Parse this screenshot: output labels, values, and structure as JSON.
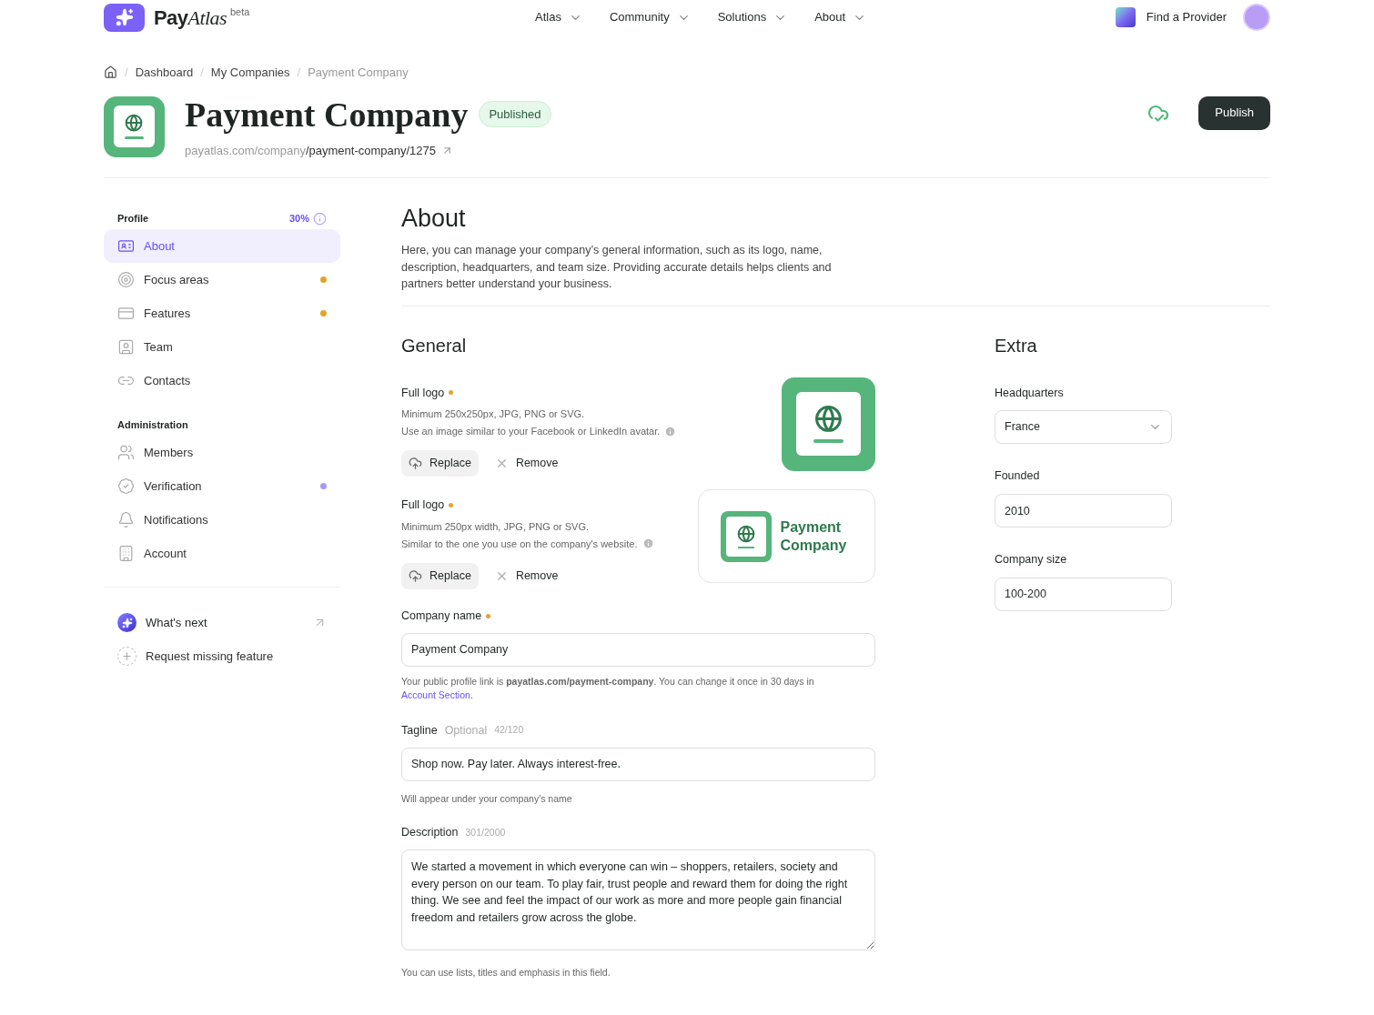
{
  "brand": {
    "name": "Pay",
    "name_italic": "Atlas",
    "badge": "beta"
  },
  "nav": [
    {
      "label": "Atlas"
    },
    {
      "label": "Community"
    },
    {
      "label": "Solutions"
    },
    {
      "label": "About"
    }
  ],
  "find_provider": "Find a Provider",
  "breadcrumbs": [
    {
      "separator": "/",
      "label": "Dashboard"
    },
    {
      "separator": "/",
      "label": "My Companies"
    },
    {
      "separator": "/",
      "label": "Payment Company"
    }
  ],
  "header": {
    "title": "Payment Company",
    "status": "Published",
    "url_base": "payatlas.com/company",
    "url_path": "/payment-company/1275",
    "publish_button": "Publish"
  },
  "sidebar": {
    "sections": [
      {
        "title": "Profile",
        "progress": "30%",
        "items": [
          {
            "label": "About",
            "selected": true
          },
          {
            "label": "Focus areas",
            "selected": false,
            "color": "#e0a530"
          },
          {
            "label": "Features",
            "selected": false,
            "color": "#e0a530"
          },
          {
            "label": "Team",
            "selected": false
          },
          {
            "label": "Contacts",
            "selected": false
          }
        ]
      },
      {
        "title": "Administration",
        "items": [
          {
            "label": "Members",
            "selected": false
          },
          {
            "label": "Verification",
            "selected": false,
            "color": "#a799f7"
          },
          {
            "label": "Notifications",
            "selected": false
          },
          {
            "label": "Account",
            "selected": false
          }
        ]
      }
    ],
    "footer": [
      {
        "label": "What's next",
        "kind": "whatsnext"
      },
      {
        "label": "Request missing feature",
        "kind": "request"
      }
    ]
  },
  "about": {
    "title": "About",
    "description": "Here, you can manage your company’s general information, such as its logo, name, description, headquarters, and team size. Providing accurate details helps clients and partners better understand your business."
  },
  "general": {
    "title": "General",
    "logos": [
      {
        "label": "Full logo",
        "hint1": "Minimum 250x250px, JPG, PNG or SVG.",
        "hint2": "Use an image similar to your Facebook or LinkedIn avatar.",
        "replace": "Replace",
        "remove": "Remove",
        "kind": "square"
      },
      {
        "label": "Full logo",
        "hint1": "Minimum 250px width, JPG, PNG or SVG.",
        "hint2": "Similar to the one you use on the company's website.",
        "replace": "Replace",
        "remove": "Remove",
        "kind": "wide",
        "logo_text": "Payment Company"
      }
    ],
    "company_name": {
      "label": "Company name",
      "value": "Payment Company",
      "hint": "Your public profile link is **payatlas.com/payment-company**. You can change it once in 30 days in",
      "link": "Account Section",
      "hint_end": "."
    },
    "tagline": {
      "label": "Tagline",
      "optional": "Optional",
      "count": "42/120",
      "value": "Shop now. Pay later. Always interest-free.",
      "hint": "Will appear under your company's name"
    },
    "description": {
      "label": "Description",
      "count": "301/2000",
      "value": "We started a movement in which everyone can win – shoppers, retailers, society and every person on our team. To play fair, trust people and reward them for doing the right thing. We see and feel the impact of our work as more and more people gain financial freedom and retailers grow across the globe.",
      "hint": "You can use lists, titles and emphasis in this field."
    }
  },
  "extra": {
    "title": "Extra",
    "fields": [
      {
        "label": "Headquarters",
        "value": "France",
        "kind": "select"
      },
      {
        "label": "Founded",
        "value": "2010",
        "kind": "input"
      },
      {
        "label": "Company size",
        "value": "100-200",
        "kind": "input"
      }
    ]
  }
}
